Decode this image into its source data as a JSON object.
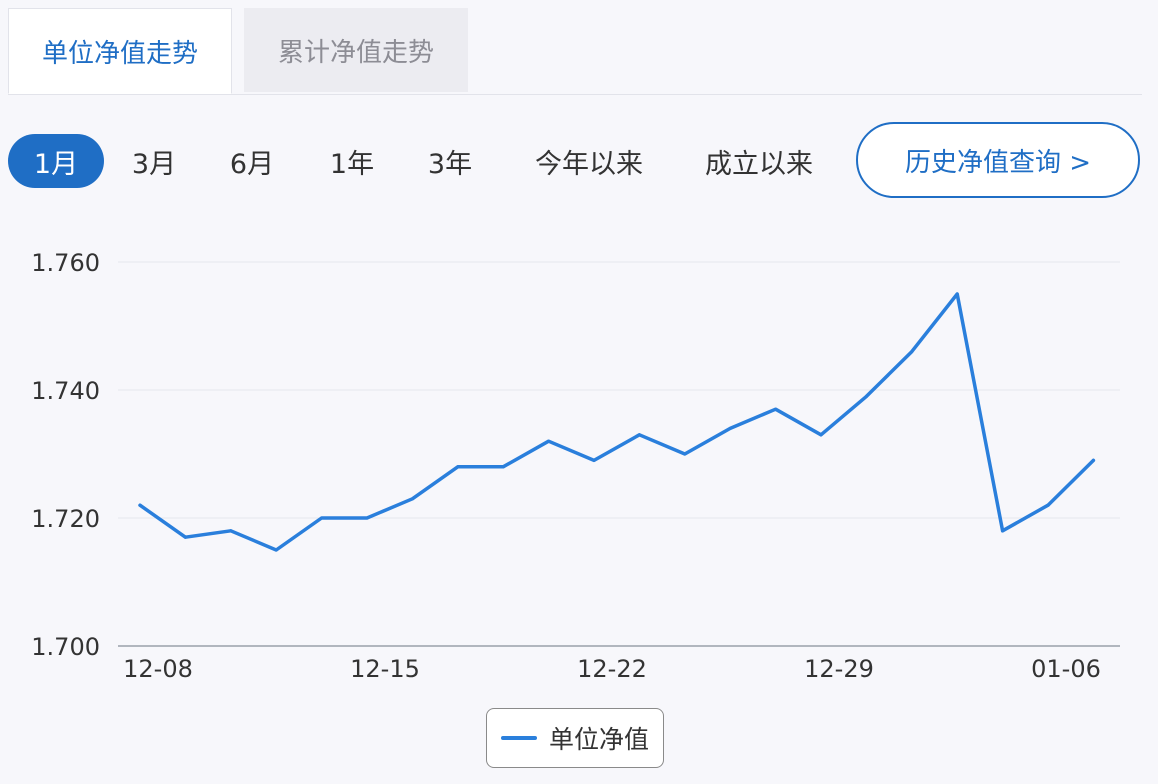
{
  "tabs": [
    {
      "label": "单位净值走势",
      "active": true
    },
    {
      "label": "累计净值走势",
      "active": false
    }
  ],
  "ranges": [
    {
      "label": "1月",
      "active": true
    },
    {
      "label": "3月",
      "active": false
    },
    {
      "label": "6月",
      "active": false
    },
    {
      "label": "1年",
      "active": false
    },
    {
      "label": "3年",
      "active": false
    },
    {
      "label": "今年以来",
      "active": false
    },
    {
      "label": "成立以来",
      "active": false
    }
  ],
  "history_button": "历史净值查询 >",
  "colors": {
    "accent": "#1f6ec5",
    "line": "#2a7fdc"
  },
  "chart_data": {
    "type": "line",
    "x": [
      "12-08",
      "12-09",
      "12-10",
      "12-11",
      "12-14",
      "12-15",
      "12-16",
      "12-17",
      "12-18",
      "12-21",
      "12-22",
      "12-23",
      "12-24",
      "12-25",
      "12-28",
      "12-29",
      "12-30",
      "12-31",
      "01-04",
      "01-05",
      "01-06",
      "01-07"
    ],
    "series": [
      {
        "name": "单位净值",
        "values": [
          1.722,
          1.717,
          1.718,
          1.715,
          1.72,
          1.72,
          1.723,
          1.728,
          1.728,
          1.732,
          1.729,
          1.733,
          1.73,
          1.734,
          1.737,
          1.733,
          1.739,
          1.746,
          1.755,
          1.718,
          1.722,
          1.729
        ]
      }
    ],
    "x_tick_labels": [
      "12-08",
      "12-15",
      "12-22",
      "12-29",
      "01-06"
    ],
    "y_ticks": [
      "1.700",
      "1.720",
      "1.740",
      "1.760"
    ],
    "ylim": [
      1.7,
      1.76
    ],
    "grid": true,
    "legend": "bottom-center"
  }
}
